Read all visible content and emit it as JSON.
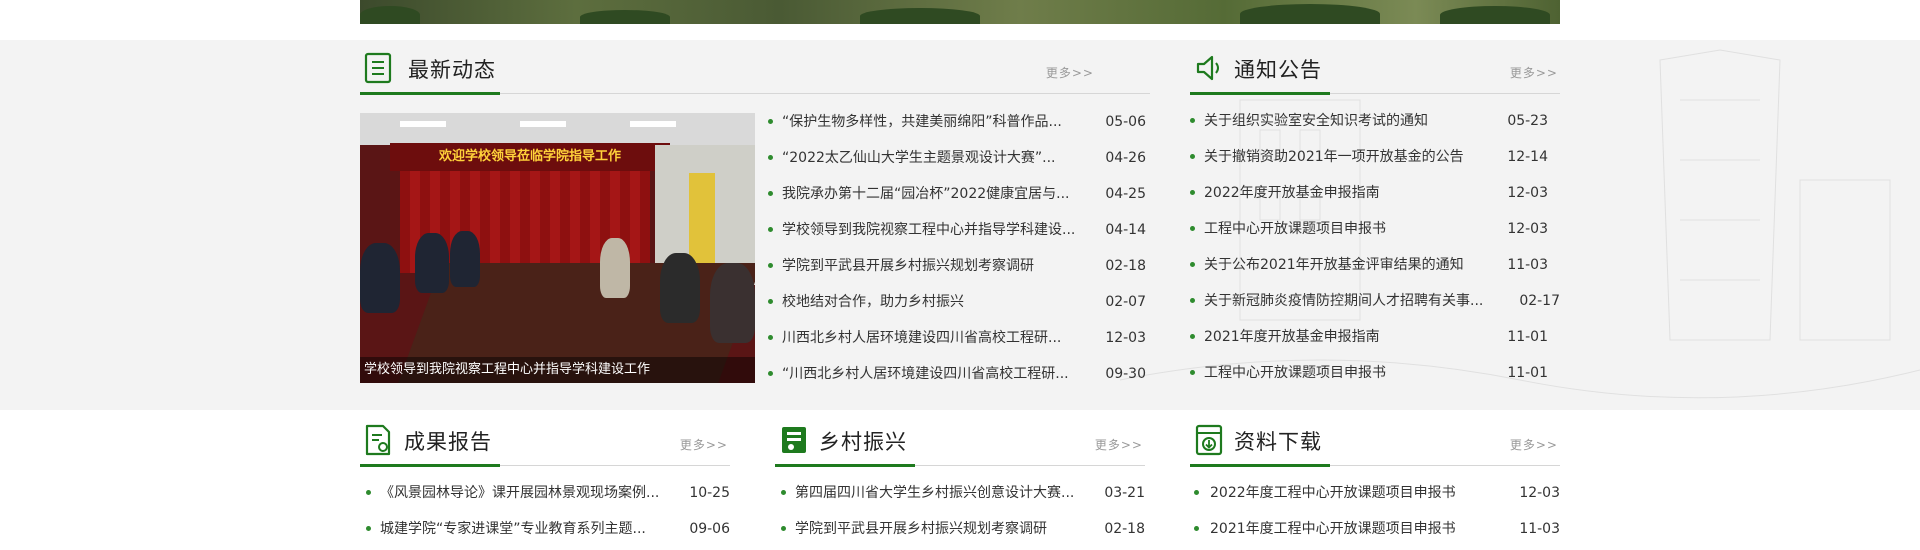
{
  "sections": {
    "latest": {
      "title": "最新动态",
      "more": "更多>>",
      "photo_caption": "学校领导到我院视察工程中心并指导学科建设工作",
      "photo_banner": "欢迎学校领导莅临学院指导工作",
      "items": [
        {
          "title": "“保护生物多样性，共建美丽绵阳”科普作品...",
          "date": "05-06"
        },
        {
          "title": "“2022太乙仙山大学生主题景观设计大赛”...",
          "date": "04-26"
        },
        {
          "title": "我院承办第十二届“园冶杯”2022健康宜居与...",
          "date": "04-25"
        },
        {
          "title": "学校领导到我院视察工程中心并指导学科建设...",
          "date": "04-14"
        },
        {
          "title": "学院到平武县开展乡村振兴规划考察调研",
          "date": "02-18"
        },
        {
          "title": "校地结对合作，助力乡村振兴",
          "date": "02-07"
        },
        {
          "title": "川西北乡村人居环境建设四川省高校工程研...",
          "date": "12-03"
        },
        {
          "title": "“川西北乡村人居环境建设四川省高校工程研...",
          "date": "09-30"
        }
      ]
    },
    "notice": {
      "title": "通知公告",
      "more": "更多>>",
      "items": [
        {
          "title": "关于组织实验室安全知识考试的通知",
          "date": "05-23"
        },
        {
          "title": "关于撤销资助2021年一项开放基金的公告",
          "date": "12-14"
        },
        {
          "title": "2022年度开放基金申报指南",
          "date": "12-03"
        },
        {
          "title": "工程中心开放课题项目申报书",
          "date": "12-03"
        },
        {
          "title": "关于公布2021年开放基金评审结果的通知",
          "date": "11-03"
        },
        {
          "title": "关于新冠肺炎疫情防控期间人才招聘有关事...",
          "date": "02-17"
        },
        {
          "title": "2021年度开放基金申报指南",
          "date": "11-01"
        },
        {
          "title": "工程中心开放课题项目申报书",
          "date": "11-01"
        }
      ]
    },
    "results": {
      "title": "成果报告",
      "more": "更多>>",
      "items": [
        {
          "title": "《风景园林导论》课开展园林景观现场案例...",
          "date": "10-25"
        },
        {
          "title": "城建学院“专家进课堂”专业教育系列主题...",
          "date": "09-06"
        }
      ]
    },
    "rural": {
      "title": "乡村振兴",
      "more": "更多>>",
      "items": [
        {
          "title": "第四届四川省大学生乡村振兴创意设计大赛...",
          "date": "03-21"
        },
        {
          "title": "学院到平武县开展乡村振兴规划考察调研",
          "date": "02-18"
        }
      ]
    },
    "downloads": {
      "title": "资料下载",
      "more": "更多>>",
      "items": [
        {
          "title": "2022年度工程中心开放课题项目申报书",
          "date": "12-03"
        },
        {
          "title": "2021年度工程中心开放课题项目申报书",
          "date": "11-03"
        }
      ]
    }
  },
  "colors": {
    "accent": "#1e7a1e",
    "dot": "#2e8b2e",
    "band": "#f3f3f3"
  },
  "icons": {
    "latest": "list-doc-icon",
    "notice": "speaker-icon",
    "results": "report-doc-icon",
    "rural": "village-book-icon",
    "downloads": "download-doc-icon"
  }
}
